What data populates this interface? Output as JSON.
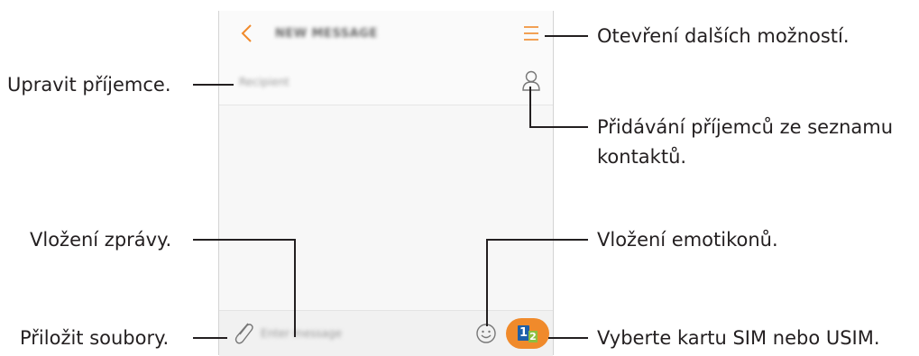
{
  "screen": {
    "title": "NEW MESSAGE",
    "recipient_placeholder": "Recipient",
    "compose_placeholder": "Enter message",
    "sim_card_1": "1",
    "sim_card_2": "2"
  },
  "callouts": {
    "more_options": "Otevření dalších možností.",
    "edit_recipients": "Upravit příjemce.",
    "add_from_contacts_line1": "Přidávání příjemců ze seznamu",
    "add_from_contacts_line2": "kontaktů.",
    "insert_message": "Vložení zprávy.",
    "insert_emoticons": "Vložení emotikonů.",
    "attach_files": "Přiložit soubory.",
    "select_sim": "Vyberte kartu SIM nebo USIM."
  },
  "colors": {
    "accent": "#f08a2b",
    "sim1": "#1d5fa8",
    "sim2": "#8dbf3f"
  },
  "icons": [
    "back-icon",
    "more-options-icon",
    "contact-icon",
    "attach-icon",
    "emoticon-icon",
    "sim-card-icon"
  ]
}
